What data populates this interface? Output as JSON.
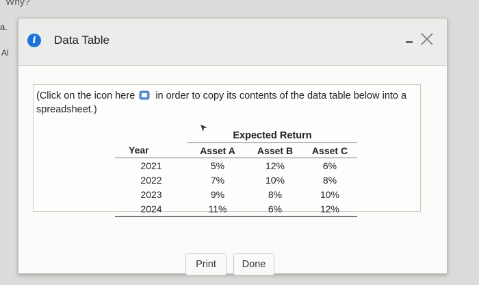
{
  "background": {
    "fragments": [
      "Why?",
      "a.",
      "Al"
    ]
  },
  "dialog": {
    "title": "Data Table",
    "info_icon_glyph": "i",
    "instruction": {
      "before": "(Click on the icon here",
      "after": "in order to copy its contents of the data table below into a spreadsheet.)"
    },
    "table": {
      "group_header": "Expected Return",
      "columns": [
        "Year",
        "Asset A",
        "Asset B",
        "Asset C"
      ],
      "rows": [
        [
          "2021",
          "5%",
          "12%",
          "6%"
        ],
        [
          "2022",
          "7%",
          "10%",
          "8%"
        ],
        [
          "2023",
          "9%",
          "8%",
          "10%"
        ],
        [
          "2024",
          "11%",
          "6%",
          "12%"
        ]
      ]
    },
    "buttons": {
      "print": "Print",
      "done": "Done"
    }
  },
  "colors": {
    "accent": "#1a73d6"
  },
  "icons": [
    "info-icon",
    "minimize-icon",
    "close-icon",
    "copy-icon",
    "cursor-arrow-icon"
  ]
}
